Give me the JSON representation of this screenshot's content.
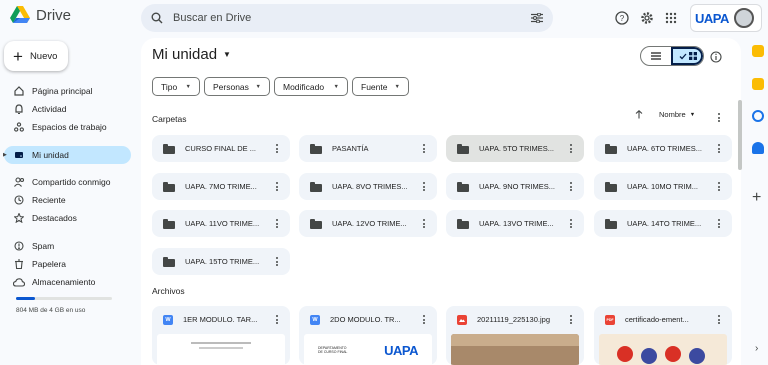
{
  "app": {
    "name": "Drive"
  },
  "search": {
    "placeholder": "Buscar en Drive"
  },
  "org": {
    "name": "UAPA"
  },
  "sidebar": {
    "new_label": "Nuevo",
    "items": [
      {
        "label": "Página principal",
        "icon": "home-icon"
      },
      {
        "label": "Actividad",
        "icon": "bell-icon"
      },
      {
        "label": "Espacios de trabajo",
        "icon": "workspaces-icon"
      },
      {
        "label": "Mi unidad",
        "icon": "drive-icon"
      },
      {
        "label": "Compartido conmigo",
        "icon": "people-icon"
      },
      {
        "label": "Reciente",
        "icon": "clock-icon"
      },
      {
        "label": "Destacados",
        "icon": "star-icon"
      },
      {
        "label": "Spam",
        "icon": "spam-icon"
      },
      {
        "label": "Papelera",
        "icon": "trash-icon"
      },
      {
        "label": "Almacenamiento",
        "icon": "cloud-icon"
      }
    ],
    "storage": {
      "text": "804 MB de 4 GB en uso",
      "fraction": 0.2
    }
  },
  "main": {
    "title": "Mi unidad",
    "filters": [
      "Tipo",
      "Personas",
      "Modificado",
      "Fuente"
    ],
    "sort_label": "Nombre",
    "folders_label": "Carpetas",
    "files_label": "Archivos",
    "folders": [
      "CURSO FINAL DE ...",
      "PASANTÍA",
      "UAPA. 5TO TRIMES...",
      "UAPA. 6TO TRIMES...",
      "UAPA. 7MO TRIME...",
      "UAPA. 8VO TRIMES...",
      "UAPA. 9NO TRIMES...",
      "UAPA. 10MO TRIM...",
      "UAPA. 11VO TRIME...",
      "UAPA. 12VO TRIME...",
      "UAPA. 13VO TRIME...",
      "UAPA. 14TO TRIME...",
      "UAPA. 15TO TRIME..."
    ],
    "files": [
      {
        "name": "1ER MODULO. TAR...",
        "type": "W",
        "color": "#4285f4"
      },
      {
        "name": "2DO MODULO. TR...",
        "type": "W",
        "color": "#4285f4"
      },
      {
        "name": "20211119_225130.jpg",
        "type": "",
        "color": "#ea4335"
      },
      {
        "name": "certificado-ement...",
        "type": "PDF",
        "color": "#ea4335"
      }
    ],
    "thumb_text": {
      "dept": "DEPARTAMENTO",
      "course": "DE CURSO FINAL",
      "brand": "UAPA"
    }
  },
  "colors": {
    "accent": "#0b57d0",
    "active_bg": "#c2e7ff",
    "surface": "#f0f4f9"
  }
}
